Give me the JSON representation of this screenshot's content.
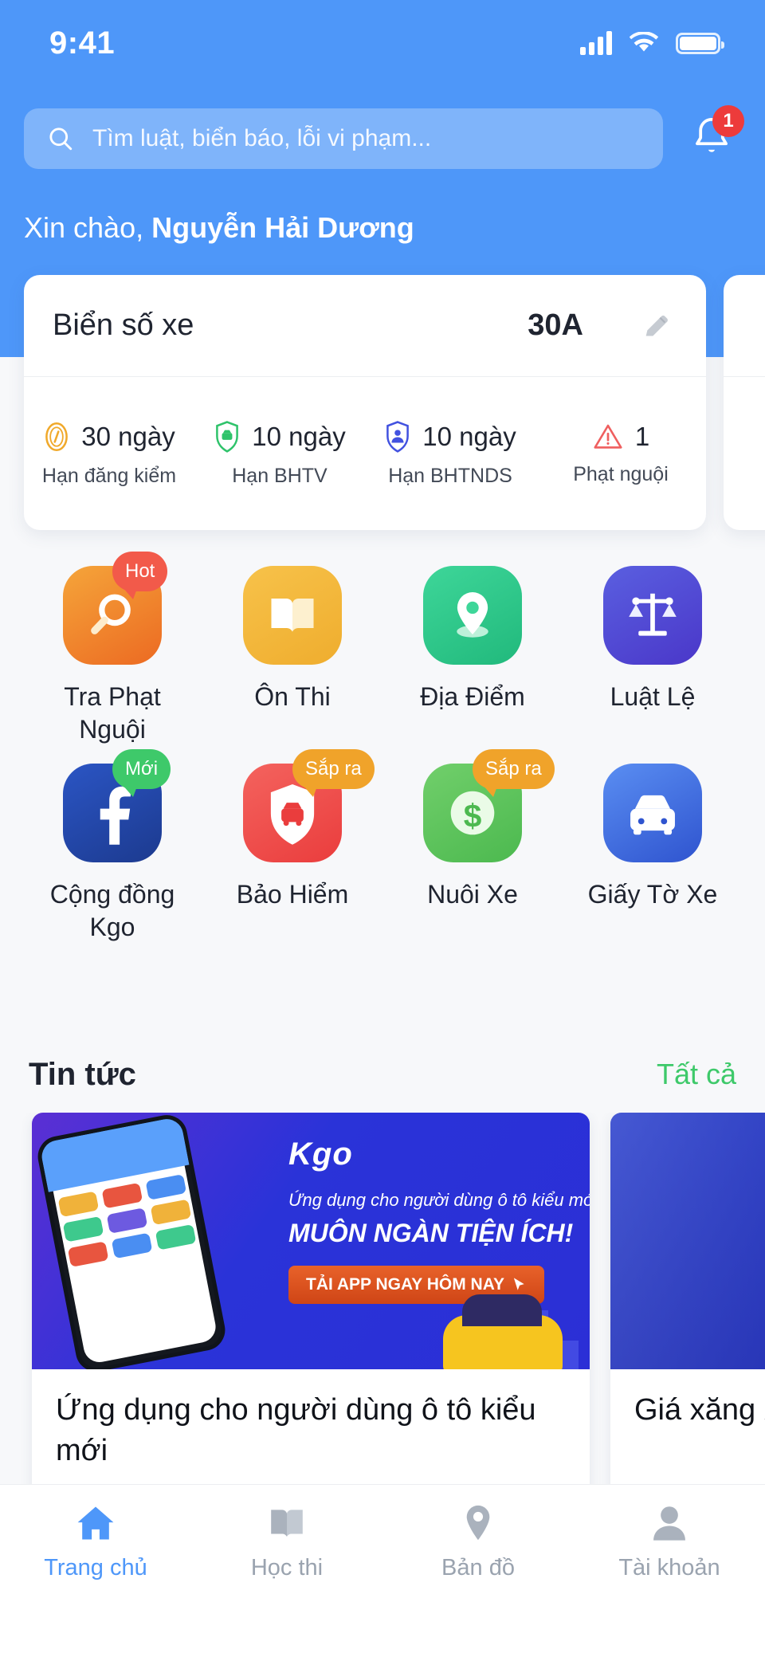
{
  "statusbar": {
    "time": "9:41",
    "signal_icon": "cellular-signal-icon",
    "wifi_icon": "wifi-icon",
    "battery_icon": "battery-icon"
  },
  "search": {
    "placeholder": "Tìm luật, biển báo, lỗi vi phạm...",
    "icon": "search-icon"
  },
  "notification": {
    "icon": "bell-icon",
    "count": "1",
    "color": "#ed3b3b"
  },
  "greeting": {
    "prefix": "Xin chào, ",
    "name": "Nguyễn Hải Dương"
  },
  "vehicle_card": {
    "label": "Biển số xe",
    "plate": "30A",
    "edit_icon": "pencil-icon",
    "stats": [
      {
        "value": "30 ngày",
        "caption": "Hạn đăng kiểm",
        "icon": "inspection-badge-icon",
        "color": "#f0a92b"
      },
      {
        "value": "10 ngày",
        "caption": "Hạn BHTV",
        "icon": "shield-car-icon",
        "color": "#2fc36b"
      },
      {
        "value": "10 ngày",
        "caption": "Hạn BHTNDS",
        "icon": "shield-person-icon",
        "color": "#4252e0"
      },
      {
        "value": "1",
        "caption": "Phạt nguội",
        "icon": "warning-triangle-icon",
        "color": "#ef5f5f"
      }
    ]
  },
  "apps": [
    {
      "label": "Tra Phạt Nguội",
      "icon": "magnifier-icon",
      "badge": "Hot",
      "badge_color": "#f25a4a",
      "bg_from": "#f5a53a",
      "bg_to": "#ec6a22"
    },
    {
      "label": "Ôn Thi",
      "icon": "open-book-icon",
      "badge": "",
      "badge_color": "",
      "bg_from": "#f7c24a",
      "bg_to": "#efad2e"
    },
    {
      "label": "Địa Điểm",
      "icon": "map-pin-icon",
      "badge": "",
      "badge_color": "",
      "bg_from": "#3ed699",
      "bg_to": "#21b97c"
    },
    {
      "label": "Luật Lệ",
      "icon": "scales-justice-icon",
      "badge": "",
      "badge_color": "",
      "bg_from": "#5a5fe0",
      "bg_to": "#4a37c9"
    },
    {
      "label": "Cộng đồng Kgo",
      "icon": "facebook-icon",
      "badge": "Mới",
      "badge_color": "#3ec96a",
      "bg_from": "#2b55c4",
      "bg_to": "#1c3a8f"
    },
    {
      "label": "Bảo Hiểm",
      "icon": "shield-car-icon",
      "badge": "Sắp ra",
      "badge_color": "#f0a32a",
      "bg_from": "#f4635e",
      "bg_to": "#ea3d3d"
    },
    {
      "label": "Nuôi Xe",
      "icon": "dollar-coin-icon",
      "badge": "Sắp ra",
      "badge_color": "#f0a32a",
      "bg_from": "#71cf6b",
      "bg_to": "#4cb94f"
    },
    {
      "label": "Giấy Tờ Xe",
      "icon": "car-front-icon",
      "badge": "",
      "badge_color": "",
      "bg_from": "#5a8ef2",
      "bg_to": "#2f54cf"
    }
  ],
  "news": {
    "title": "Tin tức",
    "all_label": "Tất cả",
    "items": [
      {
        "title": "Ứng dụng cho người dùng ô tô kiểu mới",
        "banner": {
          "logo": "Kgo",
          "subtitle": "Ứng dụng cho người dùng ô tô kiểu mới",
          "headline": "MUÔN NGÀN TIỆN ÍCH!",
          "cta": "TẢI APP NGAY HÔM NAY",
          "cursor_icon": "cursor-pointer-icon"
        }
      },
      {
        "title": "Giá xăng\nXăng tăng",
        "banner": null
      }
    ]
  },
  "bottom_nav": [
    {
      "label": "Trang chủ",
      "icon": "home-icon",
      "active": true
    },
    {
      "label": "Học thi",
      "icon": "book-icon",
      "active": false
    },
    {
      "label": "Bản đồ",
      "icon": "map-pin-icon",
      "active": false
    },
    {
      "label": "Tài khoản",
      "icon": "person-icon",
      "active": false
    }
  ],
  "colors": {
    "primary": "#4e97f9",
    "accent_green": "#3ec96a",
    "danger": "#ed3b3b"
  }
}
